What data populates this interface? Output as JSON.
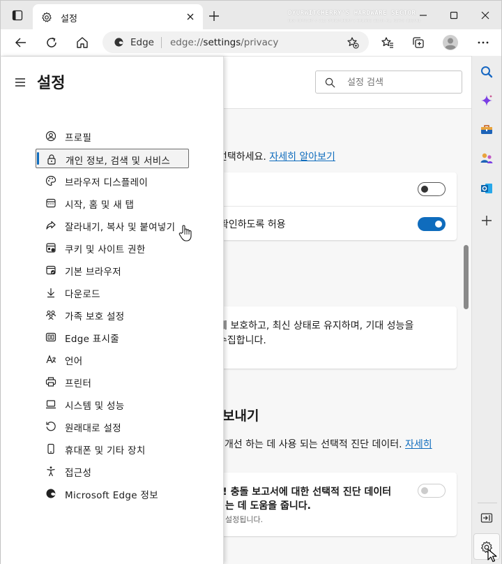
{
  "window": {
    "tab_title": "설정",
    "watermark_title": "DYURWITCHERRY'S HARDWARE SECTOR",
    "watermark_sub": "BLOG COPYRIGHT © 2012 DYURWITCHERRY'S HARDWARE SECTOR ALL RIGHTS RESERVED"
  },
  "address_bar": {
    "site_label": "Edge",
    "url_prefix": "edge://",
    "url_host": "settings",
    "url_path": "/privacy"
  },
  "header": {
    "search_placeholder": "설정 검색"
  },
  "flyout": {
    "title": "설정",
    "items": [
      {
        "label": "프로필",
        "icon": "profile-icon"
      },
      {
        "label": "개인 정보, 검색 및 서비스",
        "icon": "lock-icon",
        "selected": true
      },
      {
        "label": "브라우저 디스플레이",
        "icon": "palette-icon"
      },
      {
        "label": "시작, 홈 및 새 탭",
        "icon": "home-page-icon"
      },
      {
        "label": "잘라내기, 복사 및 붙여넣기",
        "icon": "share-icon"
      },
      {
        "label": "쿠키 및 사이트 권한",
        "icon": "cookie-icon"
      },
      {
        "label": "기본 브라우저",
        "icon": "default-browser-icon"
      },
      {
        "label": "다운로드",
        "icon": "download-icon"
      },
      {
        "label": "가족 보호 설정",
        "icon": "family-icon"
      },
      {
        "label": "Edge 표시줄",
        "icon": "edge-bar-icon"
      },
      {
        "label": "언어",
        "icon": "language-icon"
      },
      {
        "label": "프린터",
        "icon": "printer-icon"
      },
      {
        "label": "시스템 및 성능",
        "icon": "laptop-icon"
      },
      {
        "label": "원래대로 설정",
        "icon": "reset-icon"
      },
      {
        "label": "휴대폰 및 기타 장치",
        "icon": "phone-icon"
      },
      {
        "label": "접근성",
        "icon": "accessibility-icon"
      },
      {
        "label": "Microsoft Edge 정보",
        "icon": "edge-logo-icon"
      }
    ]
  },
  "background": {
    "line1": "선택하세요.",
    "line1_link": "자세히 알아보기",
    "card1_row2": "확인하도록 허용",
    "card2_line1": "에 보호하고, 최신 상태로 유지하며, 기대 성능을",
    "card2_line2": "수집합니다.",
    "section_heading": "보내기",
    "section_desc": "개선 하는 데 사용 되는 선택적 진단 데이터.",
    "section_link": "자세히",
    "card3_line1": "!! 충돌 보고서에 대한 선택적 진단 데이터",
    "card3_line2": "는 데 도움을 줍니다.",
    "card3_sub": "설정됩니다."
  },
  "toggles": {
    "card1_row1": "off",
    "card1_row2": "on",
    "card3": "disabled"
  },
  "colors": {
    "accent": "#0f6cbd",
    "page_bg": "#f7f7f7",
    "titlebar_bg": "#e9e9e9"
  }
}
